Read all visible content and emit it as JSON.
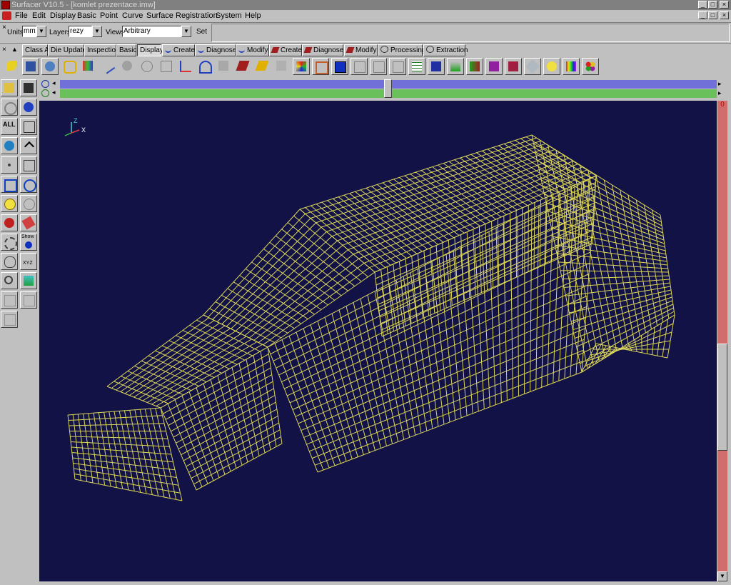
{
  "window": {
    "title": "Surfacer V10.5  - [komlet prezentace.imw]"
  },
  "menu": [
    "File",
    "Edit",
    "Display",
    "Basic",
    "Point",
    "Curve",
    "Surface",
    "Registration",
    "System",
    "Help"
  ],
  "units_bar": {
    "units_label": "Units",
    "units_value": "mm",
    "layers_label": "Layers",
    "layers_value": "rezy po",
    "views_label": "Views",
    "views_value": "Arbitrary",
    "set_label": "Set"
  },
  "tabs": [
    {
      "label": "Class A"
    },
    {
      "label": "Die Update"
    },
    {
      "label": "Inspection"
    },
    {
      "label": "Basic"
    },
    {
      "label": "Display",
      "active": true
    },
    {
      "label": "Create"
    },
    {
      "label": "Diagnose"
    },
    {
      "label": "Modify"
    },
    {
      "label": "Create"
    },
    {
      "label": "Diagnose"
    },
    {
      "label": "Modify"
    },
    {
      "label": "Processing"
    },
    {
      "label": "Extraction"
    }
  ],
  "left_toolbar": {
    "all_label": "ALL",
    "show_label": "Show",
    "xyz_label": "XYZ"
  },
  "viewport": {
    "background_color": "#121246",
    "mesh_color": "#e6e05a",
    "triad": {
      "z": "Z",
      "x": "X"
    }
  },
  "scroll_marker": "0",
  "colors": {
    "chrome": "#c0c0c0",
    "slider_blue": "#7070d8",
    "slider_green": "#6ac05a",
    "scrollbar": "#d06e6e"
  }
}
